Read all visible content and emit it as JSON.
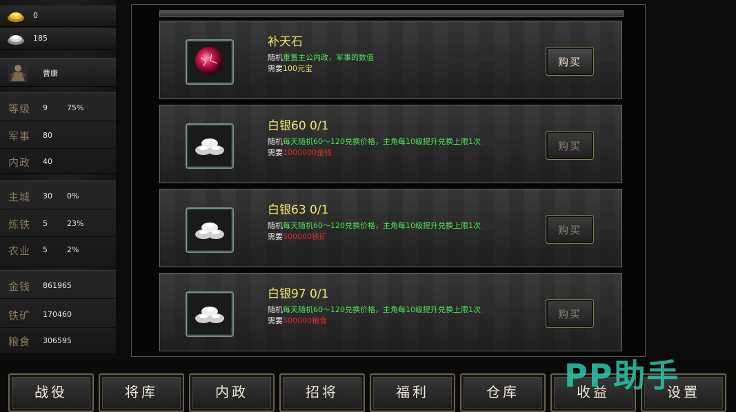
{
  "resources": {
    "gold": "0",
    "silver": "185"
  },
  "hero": {
    "name": "曹康"
  },
  "stats": {
    "level": {
      "label": "等级",
      "value": "9",
      "percent": "75%"
    },
    "military": {
      "label": "军事",
      "value": "80"
    },
    "politics": {
      "label": "内政",
      "value": "40"
    },
    "main_city": {
      "label": "主城",
      "value": "30",
      "percent": "0%"
    },
    "smelting": {
      "label": "炼铁",
      "value": "5",
      "percent": "23%"
    },
    "farming": {
      "label": "农业",
      "value": "5",
      "percent": "2%"
    },
    "money": {
      "label": "金钱",
      "value": "861965"
    },
    "iron": {
      "label": "铁矿",
      "value": "170460"
    },
    "food": {
      "label": "粮食",
      "value": "306595"
    }
  },
  "shop": {
    "items": [
      {
        "title": "补天石",
        "desc_prefix": "随机",
        "desc_highlight": "重置主公内政，军事的数值",
        "req_prefix": "需要",
        "req_value": "100元宝",
        "buy_label": "购买",
        "icon": "red-gem-icon"
      },
      {
        "title": "白银60 0/1",
        "desc_prefix": "随机",
        "desc_highlight": "每天随机60～120兑换价格，主角每10级提升兑换上限1次",
        "req_prefix": "需要",
        "req_value": "1000000金钱",
        "buy_label": "购买",
        "icon": "silver-ingots-icon"
      },
      {
        "title": "白银63 0/1",
        "desc_prefix": "随机",
        "desc_highlight": "每天随机60～120兑换价格，主角每10级提升兑换上限1次",
        "req_prefix": "需要",
        "req_value": "500000铁矿",
        "buy_label": "购买",
        "icon": "silver-ingots-icon"
      },
      {
        "title": "白银97 0/1",
        "desc_prefix": "随机",
        "desc_highlight": "每天随机60～120兑换价格，主角每10级提升兑换上限1次",
        "req_prefix": "需要",
        "req_value": "500000粮食",
        "buy_label": "购买",
        "icon": "silver-ingots-icon"
      }
    ]
  },
  "nav": {
    "tabs": [
      "战役",
      "将库",
      "内政",
      "招将",
      "福利",
      "仓库",
      "收益",
      "设置"
    ]
  },
  "watermark": "PP助手",
  "colors": {
    "title": "#f2e86c",
    "highlight": "#4ee35a",
    "insufficient": "#e02a2a",
    "label_gold": "#8a7a5a"
  }
}
